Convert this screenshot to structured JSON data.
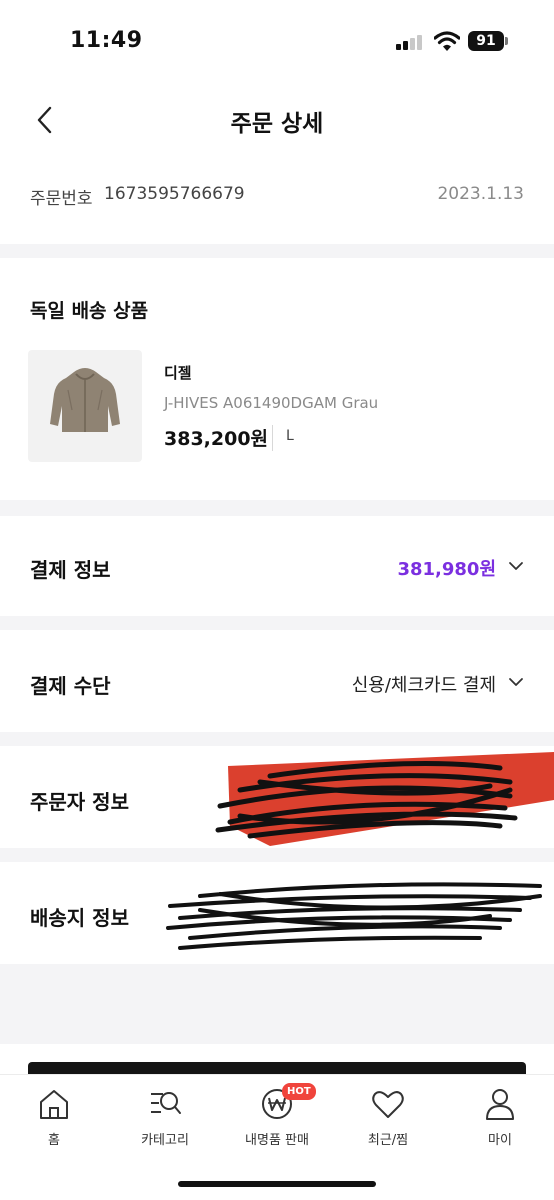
{
  "status_bar": {
    "time": "11:49",
    "battery": "91"
  },
  "header": {
    "title": "주문 상세"
  },
  "order": {
    "label": "주문번호",
    "number": "1673595766679",
    "date": "2023.1.13"
  },
  "product_section": {
    "heading": "독일 배송 상품",
    "brand": "디젤",
    "model": "J-HIVES A061490DGAM Grau",
    "price": "383,200원",
    "size": "L"
  },
  "payment_info": {
    "label": "결제 정보",
    "amount": "381,980원",
    "accent_color": "#7b2fe0"
  },
  "payment_method": {
    "label": "결제 수단",
    "value": "신용/체크카드 결제"
  },
  "orderer_info": {
    "label": "주문자 정보"
  },
  "shipping_info": {
    "label": "배송지 정보"
  },
  "tabbar": {
    "items": [
      {
        "label": "홈",
        "icon": "home-icon"
      },
      {
        "label": "카테고리",
        "icon": "category-search-icon"
      },
      {
        "label": "내명품 판매",
        "icon": "won-sell-icon",
        "badge": "HOT"
      },
      {
        "label": "최근/찜",
        "icon": "heart-icon"
      },
      {
        "label": "마이",
        "icon": "person-icon"
      }
    ]
  }
}
